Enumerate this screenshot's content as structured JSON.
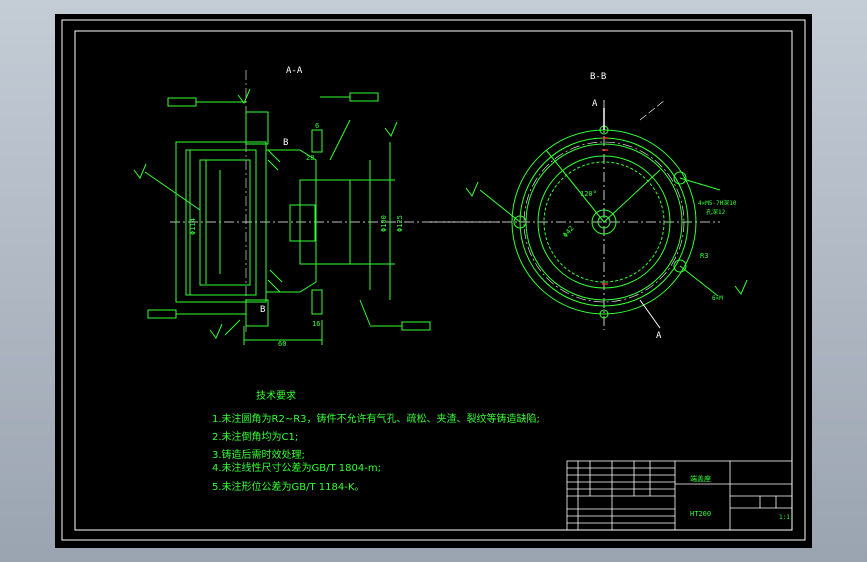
{
  "views": {
    "section_aa": "A-A",
    "section_bb": "B-B",
    "section_mark_a": "A",
    "section_mark_b": "B"
  },
  "dimensions": {
    "width_60": "60",
    "dim_6": "6",
    "dim_28": "28",
    "dim_16": "16",
    "phi_114": "Φ114",
    "phi_100": "Φ100",
    "phi_125": "Φ125",
    "phi_40": "Φ40",
    "phi_60": "Φ60",
    "phi_42": "Φ42",
    "angle_120": "120°",
    "holes": "4×M5-7H深10",
    "holes2": "孔深12",
    "r3": "R3",
    "six_x_m": "6×M"
  },
  "notes": {
    "heading": "技术要求",
    "items": [
      "1.未注圆角为R2~R3，铸件不允许有气孔、疏松、夹渣、裂纹等铸造缺陷;",
      "2.未注倒角均为C1;",
      "3.铸造后需时效处理;",
      "4.未注线性尺寸公差为GB/T 1804-m;",
      "5.未注形位公差为GB/T 1184-K。"
    ]
  },
  "title_block": {
    "part_name": "端盖座",
    "material": "HT200",
    "scale": "1:1"
  },
  "colors": {
    "background": "#000000",
    "frame": "#ffffff",
    "geometry": "#33ff33",
    "hole_markers": "#ff3333"
  }
}
